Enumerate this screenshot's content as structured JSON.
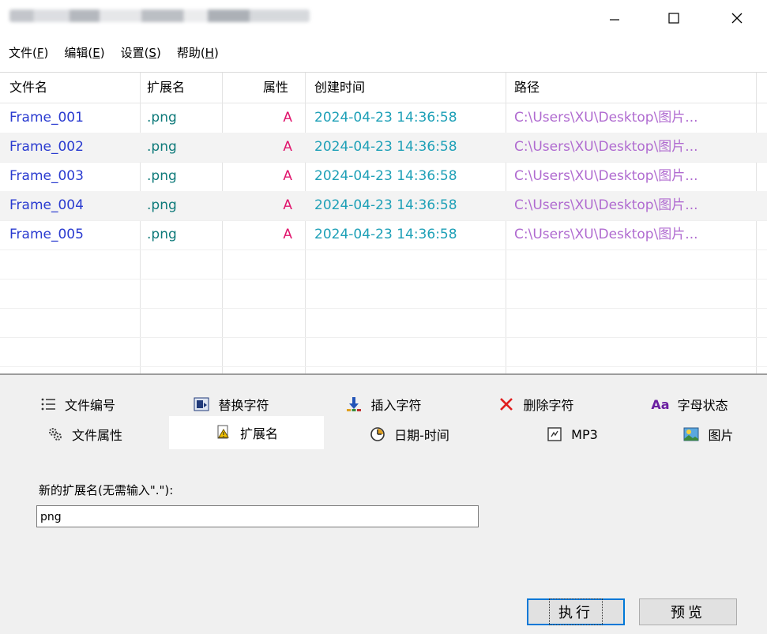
{
  "window": {
    "controls": {
      "minimize": "minimize-icon",
      "maximize": "maximize-icon",
      "close": "close-icon"
    }
  },
  "menu": [
    {
      "label": "文件(",
      "acc": "F",
      "end": ")"
    },
    {
      "label": "编辑(",
      "acc": "E",
      "end": ")"
    },
    {
      "label": "设置(",
      "acc": "S",
      "end": ")"
    },
    {
      "label": "帮助(",
      "acc": "H",
      "end": ")"
    }
  ],
  "table": {
    "headers": [
      "文件名",
      "扩展名",
      "属性",
      "创建时间",
      "路径"
    ],
    "rows": [
      {
        "name": "Frame_001",
        "ext": ".png",
        "attr": "A",
        "created": "2024-04-23 14:36:58",
        "path": "C:\\Users\\XU\\Desktop\\图片..."
      },
      {
        "name": "Frame_002",
        "ext": ".png",
        "attr": "A",
        "created": "2024-04-23 14:36:58",
        "path": "C:\\Users\\XU\\Desktop\\图片..."
      },
      {
        "name": "Frame_003",
        "ext": ".png",
        "attr": "A",
        "created": "2024-04-23 14:36:58",
        "path": "C:\\Users\\XU\\Desktop\\图片..."
      },
      {
        "name": "Frame_004",
        "ext": ".png",
        "attr": "A",
        "created": "2024-04-23 14:36:58",
        "path": "C:\\Users\\XU\\Desktop\\图片..."
      },
      {
        "name": "Frame_005",
        "ext": ".png",
        "attr": "A",
        "created": "2024-04-23 14:36:58",
        "path": "C:\\Users\\XU\\Desktop\\图片..."
      }
    ],
    "colors": {
      "name": "#2a3bd0",
      "ext": "#0e7a7a",
      "attr": "#e0146c",
      "created": "#1ea0b7",
      "path": "#b06bd0"
    }
  },
  "tabs": {
    "row1": [
      {
        "label": "文件编号",
        "icon": "list-icon"
      },
      {
        "label": "替换字符",
        "icon": "replace-icon"
      },
      {
        "label": "插入字符",
        "icon": "insert-icon"
      },
      {
        "label": "删除字符",
        "icon": "delete-icon"
      },
      {
        "label": "字母状态",
        "icon": "font-case-icon",
        "icon_text": "Aa"
      }
    ],
    "row2": [
      {
        "label": "文件属性",
        "icon": "attributes-icon"
      },
      {
        "label": "扩展名",
        "icon": "extension-icon",
        "active": true
      },
      {
        "label": "日期-时间",
        "icon": "clock-icon"
      },
      {
        "label": "MP3",
        "icon": "mp3-icon"
      },
      {
        "label": "图片",
        "icon": "picture-icon"
      }
    ]
  },
  "extension_panel": {
    "label": "新的扩展名(无需输入\".\"):",
    "value": "png"
  },
  "buttons": {
    "execute": "执行",
    "preview": "预览"
  }
}
